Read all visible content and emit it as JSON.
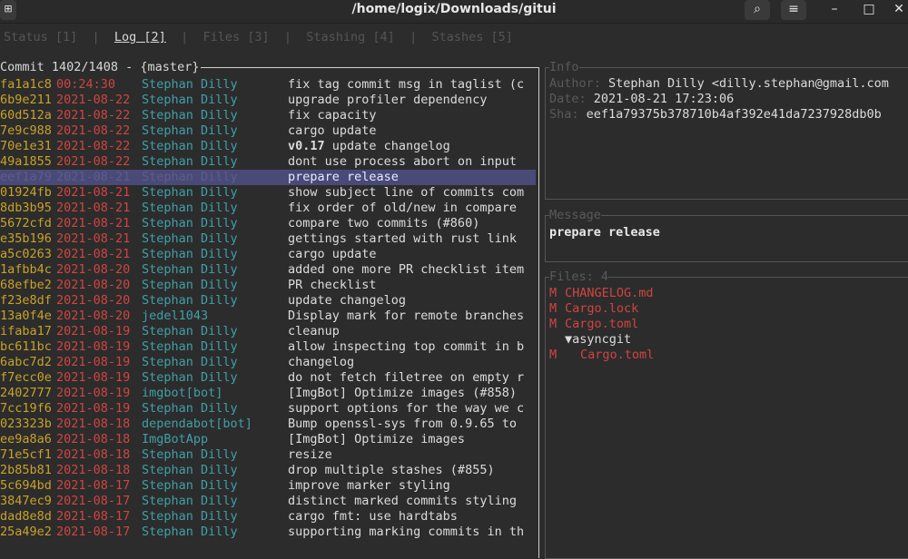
{
  "window": {
    "title": "/home/logix/Downloads/gitui",
    "icons": {
      "new_tab": "new-tab-icon",
      "search": "search-icon",
      "menu": "hamburger-menu-icon",
      "minimize": "minimize-icon",
      "maximize": "maximize-icon",
      "close": "close-icon"
    }
  },
  "tabs": [
    {
      "label": "Status [1]",
      "active": false
    },
    {
      "label": "Log [2]",
      "active": true
    },
    {
      "label": "Files [3]",
      "active": false
    },
    {
      "label": "Stashing [4]",
      "active": false
    },
    {
      "label": "Stashes [5]",
      "active": false
    }
  ],
  "log": {
    "title": "Commit 1402/1408 - {master}",
    "rows": [
      {
        "hash": "fa1a1c8",
        "date": "00:24:30",
        "author": "Stephan Dilly",
        "message": "fix tag commit msg in taglist (c"
      },
      {
        "hash": "6b9e211",
        "date": "2021-08-22",
        "author": "Stephan Dilly",
        "message": "upgrade profiler dependency"
      },
      {
        "hash": "60d512a",
        "date": "2021-08-22",
        "author": "Stephan Dilly",
        "message": "fix capacity"
      },
      {
        "hash": "7e9c988",
        "date": "2021-08-22",
        "author": "Stephan Dilly",
        "message": "cargo update"
      },
      {
        "hash": "70e1e31",
        "date": "2021-08-22",
        "author": "Stephan Dilly",
        "message_bold": "v0.17",
        "message": " update changelog"
      },
      {
        "hash": "49a1855",
        "date": "2021-08-22",
        "author": "Stephan Dilly",
        "message": "dont use process abort on input"
      },
      {
        "hash": "eef1a79",
        "date": "2021-08-21",
        "author": "Stephan Dilly",
        "message": "prepare release",
        "selected": true
      },
      {
        "hash": "01924fb",
        "date": "2021-08-21",
        "author": "Stephan Dilly",
        "message": "show subject line of commits com"
      },
      {
        "hash": "8db3b95",
        "date": "2021-08-21",
        "author": "Stephan Dilly",
        "message": "fix order of old/new in compare"
      },
      {
        "hash": "5672cfd",
        "date": "2021-08-21",
        "author": "Stephan Dilly",
        "message": "compare two commits (#860)"
      },
      {
        "hash": "e35b196",
        "date": "2021-08-21",
        "author": "Stephan Dilly",
        "message": "gettings started with rust link"
      },
      {
        "hash": "a5c0263",
        "date": "2021-08-21",
        "author": "Stephan Dilly",
        "message": "cargo update"
      },
      {
        "hash": "1afbb4c",
        "date": "2021-08-20",
        "author": "Stephan Dilly",
        "message": "added one more PR checklist item"
      },
      {
        "hash": "68efbe2",
        "date": "2021-08-20",
        "author": "Stephan Dilly",
        "message": "PR checklist"
      },
      {
        "hash": "f23e8df",
        "date": "2021-08-20",
        "author": "Stephan Dilly",
        "message": "update changelog"
      },
      {
        "hash": "13a0f4e",
        "date": "2021-08-20",
        "author": "jedel1043",
        "message": "Display mark for remote branches"
      },
      {
        "hash": "ifaba17",
        "date": "2021-08-19",
        "author": "Stephan Dilly",
        "message": "cleanup"
      },
      {
        "hash": "bc611bc",
        "date": "2021-08-19",
        "author": "Stephan Dilly",
        "message": "allow inspecting top commit in b"
      },
      {
        "hash": "6abc7d2",
        "date": "2021-08-19",
        "author": "Stephan Dilly",
        "message": "changelog"
      },
      {
        "hash": "f7ecc0e",
        "date": "2021-08-19",
        "author": "Stephan Dilly",
        "message": "do not fetch filetree on empty r"
      },
      {
        "hash": "2402777",
        "date": "2021-08-19",
        "author": "imgbot[bot]",
        "message": "[ImgBot] Optimize images (#858)"
      },
      {
        "hash": "7cc19f6",
        "date": "2021-08-19",
        "author": "Stephan Dilly",
        "message": "support options for the way we c"
      },
      {
        "hash": "023323b",
        "date": "2021-08-18",
        "author": "dependabot[bot]",
        "message": "Bump openssl-sys from 0.9.65 to"
      },
      {
        "hash": "ee9a8a6",
        "date": "2021-08-18",
        "author": "ImgBotApp",
        "message": "[ImgBot] Optimize images"
      },
      {
        "hash": "71e5cf1",
        "date": "2021-08-18",
        "author": "Stephan Dilly",
        "message": "resize"
      },
      {
        "hash": "2b85b81",
        "date": "2021-08-18",
        "author": "Stephan Dilly",
        "message": "drop multiple stashes (#855)"
      },
      {
        "hash": "5c694bd",
        "date": "2021-08-17",
        "author": "Stephan Dilly",
        "message": "improve marker styling"
      },
      {
        "hash": "3847ec9",
        "date": "2021-08-17",
        "author": "Stephan Dilly",
        "message": "distinct marked commits styling"
      },
      {
        "hash": "dad8e8d",
        "date": "2021-08-17",
        "author": "Stephan Dilly",
        "message": "cargo fmt: use hardtabs"
      },
      {
        "hash": "25a49e2",
        "date": "2021-08-17",
        "author": "Stephan Dilly",
        "message": "supporting marking commits in th"
      }
    ]
  },
  "info": {
    "title": "Info",
    "author_label": "Author: ",
    "author": "Stephan Dilly <dilly.stephan@gmail.com",
    "date_label": "Date: ",
    "date": "2021-08-21 17:23:06",
    "sha_label": "Sha: ",
    "sha": "eef1a79375b378710b4af392e41da7237928db0b"
  },
  "message": {
    "title": "Message",
    "body": "prepare release"
  },
  "files": {
    "title": "Files: 4",
    "items": [
      {
        "status": "M",
        "name": "CHANGELOG.md",
        "type": "file"
      },
      {
        "status": "M",
        "name": "Cargo.lock",
        "type": "file"
      },
      {
        "status": "M",
        "name": "Cargo.toml",
        "type": "file"
      },
      {
        "status": "",
        "name": "▼asyncgit",
        "type": "dir"
      },
      {
        "status": "M",
        "name": "Cargo.toml",
        "type": "nested"
      }
    ]
  }
}
